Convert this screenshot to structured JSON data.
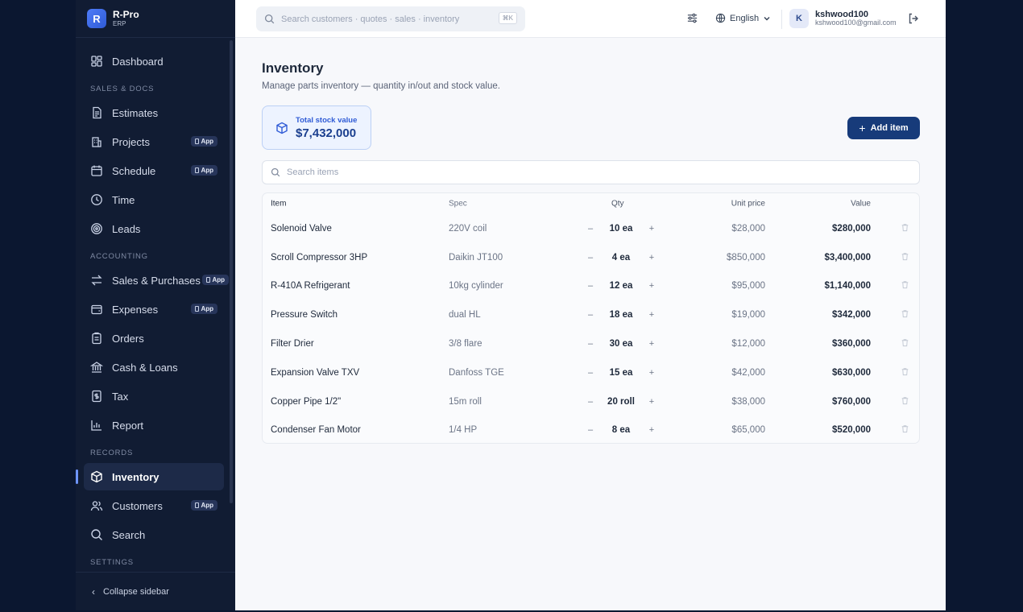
{
  "brand": {
    "logo_letter": "R",
    "name": "R-Pro",
    "sub": "ERP"
  },
  "sidebar": {
    "dashboard": "Dashboard",
    "section_sales": "SALES & DOCS",
    "estimates": "Estimates",
    "projects": "Projects",
    "schedule": "Schedule",
    "time": "Time",
    "leads": "Leads",
    "section_accounting": "ACCOUNTING",
    "sales_purchases": "Sales & Purchases",
    "expenses": "Expenses",
    "orders": "Orders",
    "cash_loans": "Cash & Loans",
    "tax": "Tax",
    "report": "Report",
    "section_records": "RECORDS",
    "inventory": "Inventory",
    "customers": "Customers",
    "search": "Search",
    "section_settings": "SETTINGS",
    "app_badge": "App",
    "collapse": "Collapse sidebar"
  },
  "topbar": {
    "search_placeholder": "Search customers · quotes · sales · inventory",
    "shortcut": "⌘K",
    "language": "English",
    "avatar_letter": "K",
    "username": "kshwood100",
    "email": "kshwood100@gmail.com"
  },
  "page": {
    "title": "Inventory",
    "subtitle": "Manage parts inventory — quantity in/out and stock value.",
    "stat_label": "Total stock value",
    "stat_value": "$7,432,000",
    "add_button": "Add item",
    "search_placeholder": "Search items"
  },
  "table": {
    "headers": {
      "item": "Item",
      "spec": "Spec",
      "qty": "Qty",
      "unit_price": "Unit price",
      "value": "Value"
    },
    "rows": [
      {
        "item": "Solenoid Valve",
        "spec": "220V coil",
        "qty": "10 ea",
        "unit_price": "$28,000",
        "value": "$280,000"
      },
      {
        "item": "Scroll Compressor 3HP",
        "spec": "Daikin JT100",
        "qty": "4 ea",
        "unit_price": "$850,000",
        "value": "$3,400,000"
      },
      {
        "item": "R-410A Refrigerant",
        "spec": "10kg cylinder",
        "qty": "12 ea",
        "unit_price": "$95,000",
        "value": "$1,140,000"
      },
      {
        "item": "Pressure Switch",
        "spec": "dual HL",
        "qty": "18 ea",
        "unit_price": "$19,000",
        "value": "$342,000"
      },
      {
        "item": "Filter Drier",
        "spec": "3/8 flare",
        "qty": "30 ea",
        "unit_price": "$12,000",
        "value": "$360,000"
      },
      {
        "item": "Expansion Valve TXV",
        "spec": "Danfoss TGE",
        "qty": "15 ea",
        "unit_price": "$42,000",
        "value": "$630,000"
      },
      {
        "item": "Copper Pipe 1/2\"",
        "spec": "15m roll",
        "qty": "20 roll",
        "unit_price": "$38,000",
        "value": "$760,000"
      },
      {
        "item": "Condenser Fan Motor",
        "spec": "1/4 HP",
        "qty": "8 ea",
        "unit_price": "$65,000",
        "value": "$520,000"
      }
    ],
    "minus": "–",
    "plus": "+"
  },
  "colors": {
    "accent": "#173b7a",
    "sidebar_bg": "#111c33",
    "outer_bg": "#0b1730",
    "stat_bg": "#edf3ff"
  }
}
